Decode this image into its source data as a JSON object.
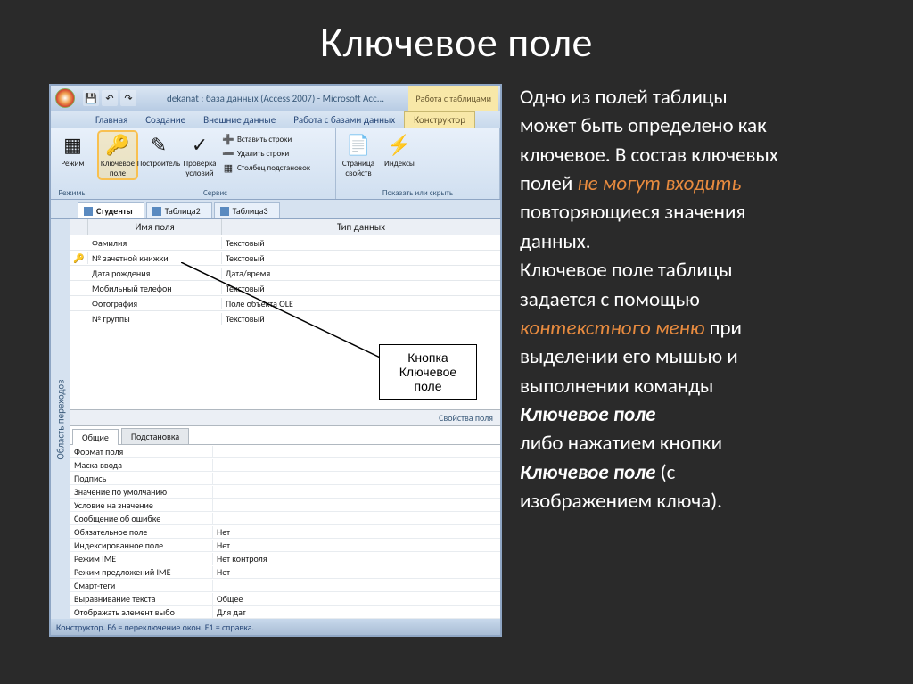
{
  "slide": {
    "title": "Ключевое поле"
  },
  "paragraph": {
    "l1": "Одно из полей таблицы",
    "l2": "может быть определено как",
    "l3": "ключевое. В состав ключевых",
    "l4a": "полей ",
    "l4b": "не могут входить",
    "l5": "повторяющиеся значения",
    "l6": "данных.",
    "l7": "Ключевое поле таблицы",
    "l8": "задается с помощью",
    "l9a": "контекстного меню",
    "l9b": " при",
    "l10": "выделении его мышью и",
    "l11": "выполнении команды",
    "l12": "Ключевое поле",
    "l13": "либо нажатием кнопки",
    "l14a": "Ключевое поле",
    "l14b": " (с",
    "l15": "изображением ключа)."
  },
  "access": {
    "title": "dekanat : база данных (Access 2007) - Microsoft Acc...",
    "contextual": "Работа с таблицами",
    "tabs": {
      "home": "Главная",
      "create": "Создание",
      "external": "Внешние данные",
      "dbtools": "Работа с базами данных",
      "design": "Конструктор"
    },
    "ribbon": {
      "group_views": "Режимы",
      "view": "Режим",
      "group_tools": "Сервис",
      "key_field": "Ключевое поле",
      "builder": "Построитель",
      "validate": "Проверка условий",
      "insert_rows": "Вставить строки",
      "delete_rows": "Удалить строки",
      "lookup_col": "Столбец подстановок",
      "group_show": "Показать или скрыть",
      "prop_sheet": "Страница свойств",
      "indexes": "Индексы"
    },
    "sidebar": "Область переходов",
    "doc_tabs": [
      "Студенты",
      "Таблица2",
      "Таблица3"
    ],
    "columns": {
      "name": "Имя поля",
      "type": "Тип данных"
    },
    "fields": [
      {
        "key": "",
        "name": "Фамилия",
        "type": "Текстовый"
      },
      {
        "key": "🔑",
        "name": "№ зачетной книжки",
        "type": "Текстовый"
      },
      {
        "key": "",
        "name": "Дата рождения",
        "type": "Дата/время"
      },
      {
        "key": "",
        "name": "Мобильный телефон",
        "type": "Текстовый"
      },
      {
        "key": "",
        "name": "Фотография",
        "type": "Поле объекта OLE"
      },
      {
        "key": "",
        "name": "№ группы",
        "type": "Текстовый"
      }
    ],
    "properties_header": "Свойства поля",
    "prop_tabs": {
      "general": "Общие",
      "lookup": "Подстановка"
    },
    "prop_rows": [
      {
        "name": "Формат поля",
        "val": ""
      },
      {
        "name": "Маска ввода",
        "val": ""
      },
      {
        "name": "Подпись",
        "val": ""
      },
      {
        "name": "Значение по умолчанию",
        "val": ""
      },
      {
        "name": "Условие на значение",
        "val": ""
      },
      {
        "name": "Сообщение об ошибке",
        "val": ""
      },
      {
        "name": "Обязательное поле",
        "val": "Нет"
      },
      {
        "name": "Индексированное поле",
        "val": "Нет"
      },
      {
        "name": "Режим IME",
        "val": "Нет контроля"
      },
      {
        "name": "Режим предложений IME",
        "val": "Нет"
      },
      {
        "name": "Смарт-теги",
        "val": ""
      },
      {
        "name": "Выравнивание текста",
        "val": "Общее"
      },
      {
        "name": "Отображать элемент выбо",
        "val": "Для дат"
      }
    ],
    "statusbar": "Конструктор.  F6 = переключение окон.  F1 = справка."
  },
  "callout": {
    "l1": "Кнопка",
    "l2": "Ключевое",
    "l3": "поле"
  }
}
